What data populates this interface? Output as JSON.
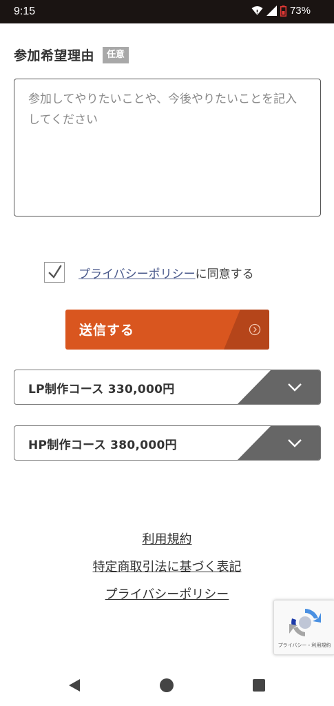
{
  "status_bar": {
    "time": "9:15",
    "battery": "73%"
  },
  "form": {
    "reason_label": "参加希望理由",
    "optional_badge": "任意",
    "reason_placeholder": "参加してやりたいことや、今後やりたいことを記入してください",
    "agree": {
      "link_text": "プライバシーポリシー",
      "suffix": "に同意する",
      "checked": true
    },
    "submit_label": "送信する"
  },
  "courses": [
    {
      "title": "LP制作コース 330,000円"
    },
    {
      "title": "HP制作コース 380,000円"
    }
  ],
  "footer": {
    "links": [
      "利用規約",
      "特定商取引法に基づく表記",
      "プライバシーポリシー"
    ]
  },
  "recaptcha": {
    "text": "プライバシー・利用規約"
  },
  "colors": {
    "accent": "#d9561f",
    "accent_dark": "#b5451a",
    "toggle": "#666666",
    "link": "#4b5a8c"
  },
  "icons": [
    "wifi-icon",
    "signal-icon",
    "battery-icon",
    "check-icon",
    "circle-arrow-right-icon",
    "chevron-down-icon",
    "recaptcha-icon",
    "nav-back-icon",
    "nav-home-icon",
    "nav-recents-icon"
  ]
}
